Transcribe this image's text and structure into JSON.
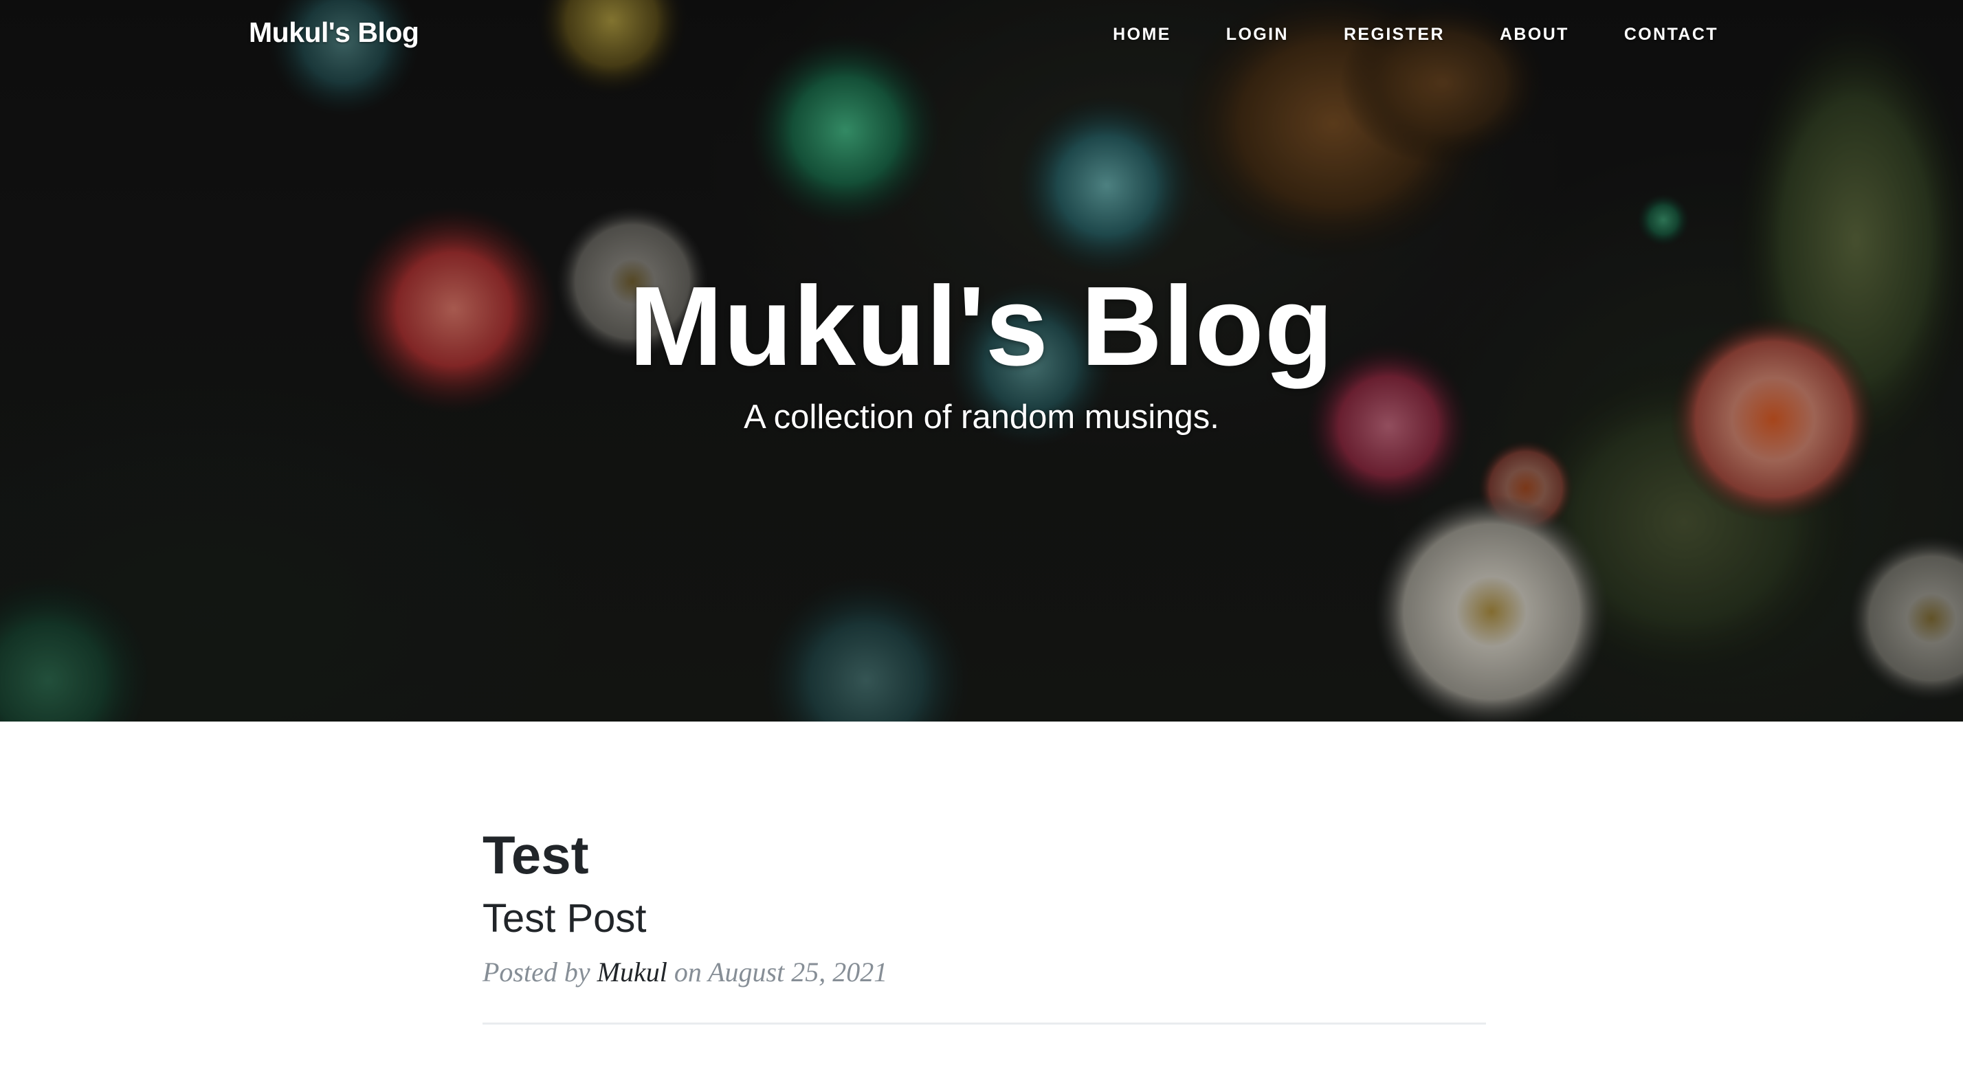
{
  "nav": {
    "brand": "Mukul's Blog",
    "links": [
      {
        "label": "HOME"
      },
      {
        "label": "LOGIN"
      },
      {
        "label": "REGISTER"
      },
      {
        "label": "ABOUT"
      },
      {
        "label": "CONTACT"
      }
    ]
  },
  "hero": {
    "title": "Mukul's Blog",
    "subtitle": "A collection of random musings."
  },
  "posts": [
    {
      "title": "Test",
      "subtitle": "Test Post",
      "meta_prefix": "Posted by ",
      "author": "Mukul",
      "meta_middle": " on ",
      "date": "August 25, 2021"
    }
  ],
  "colors": {
    "text_dark": "#212529",
    "meta_gray": "#868e96",
    "divider": "#e9ecef",
    "hero_overlay": "#1a1a1a"
  }
}
